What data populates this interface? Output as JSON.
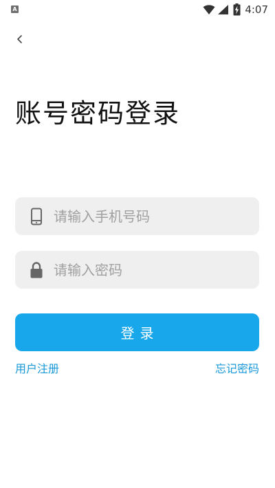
{
  "status_bar": {
    "app_icon_letter": "A",
    "time": "4:07",
    "icons": [
      "wifi-icon",
      "cellular-signal-icon",
      "battery-charging-icon"
    ]
  },
  "nav": {
    "back_icon": "chevron-left-icon"
  },
  "title": "账号密码登录",
  "form": {
    "phone": {
      "placeholder": "请输入手机号码",
      "value": "",
      "icon": "phone-icon"
    },
    "password": {
      "placeholder": "请输入密码",
      "value": "",
      "icon": "lock-icon"
    },
    "submit_label": "登录"
  },
  "links": {
    "register": "用户注册",
    "forgot_password": "忘记密码"
  },
  "colors": {
    "primary": "#18a7ea",
    "link": "#1898d8",
    "input_bg": "#efefef",
    "icon_gray": "#666666"
  }
}
